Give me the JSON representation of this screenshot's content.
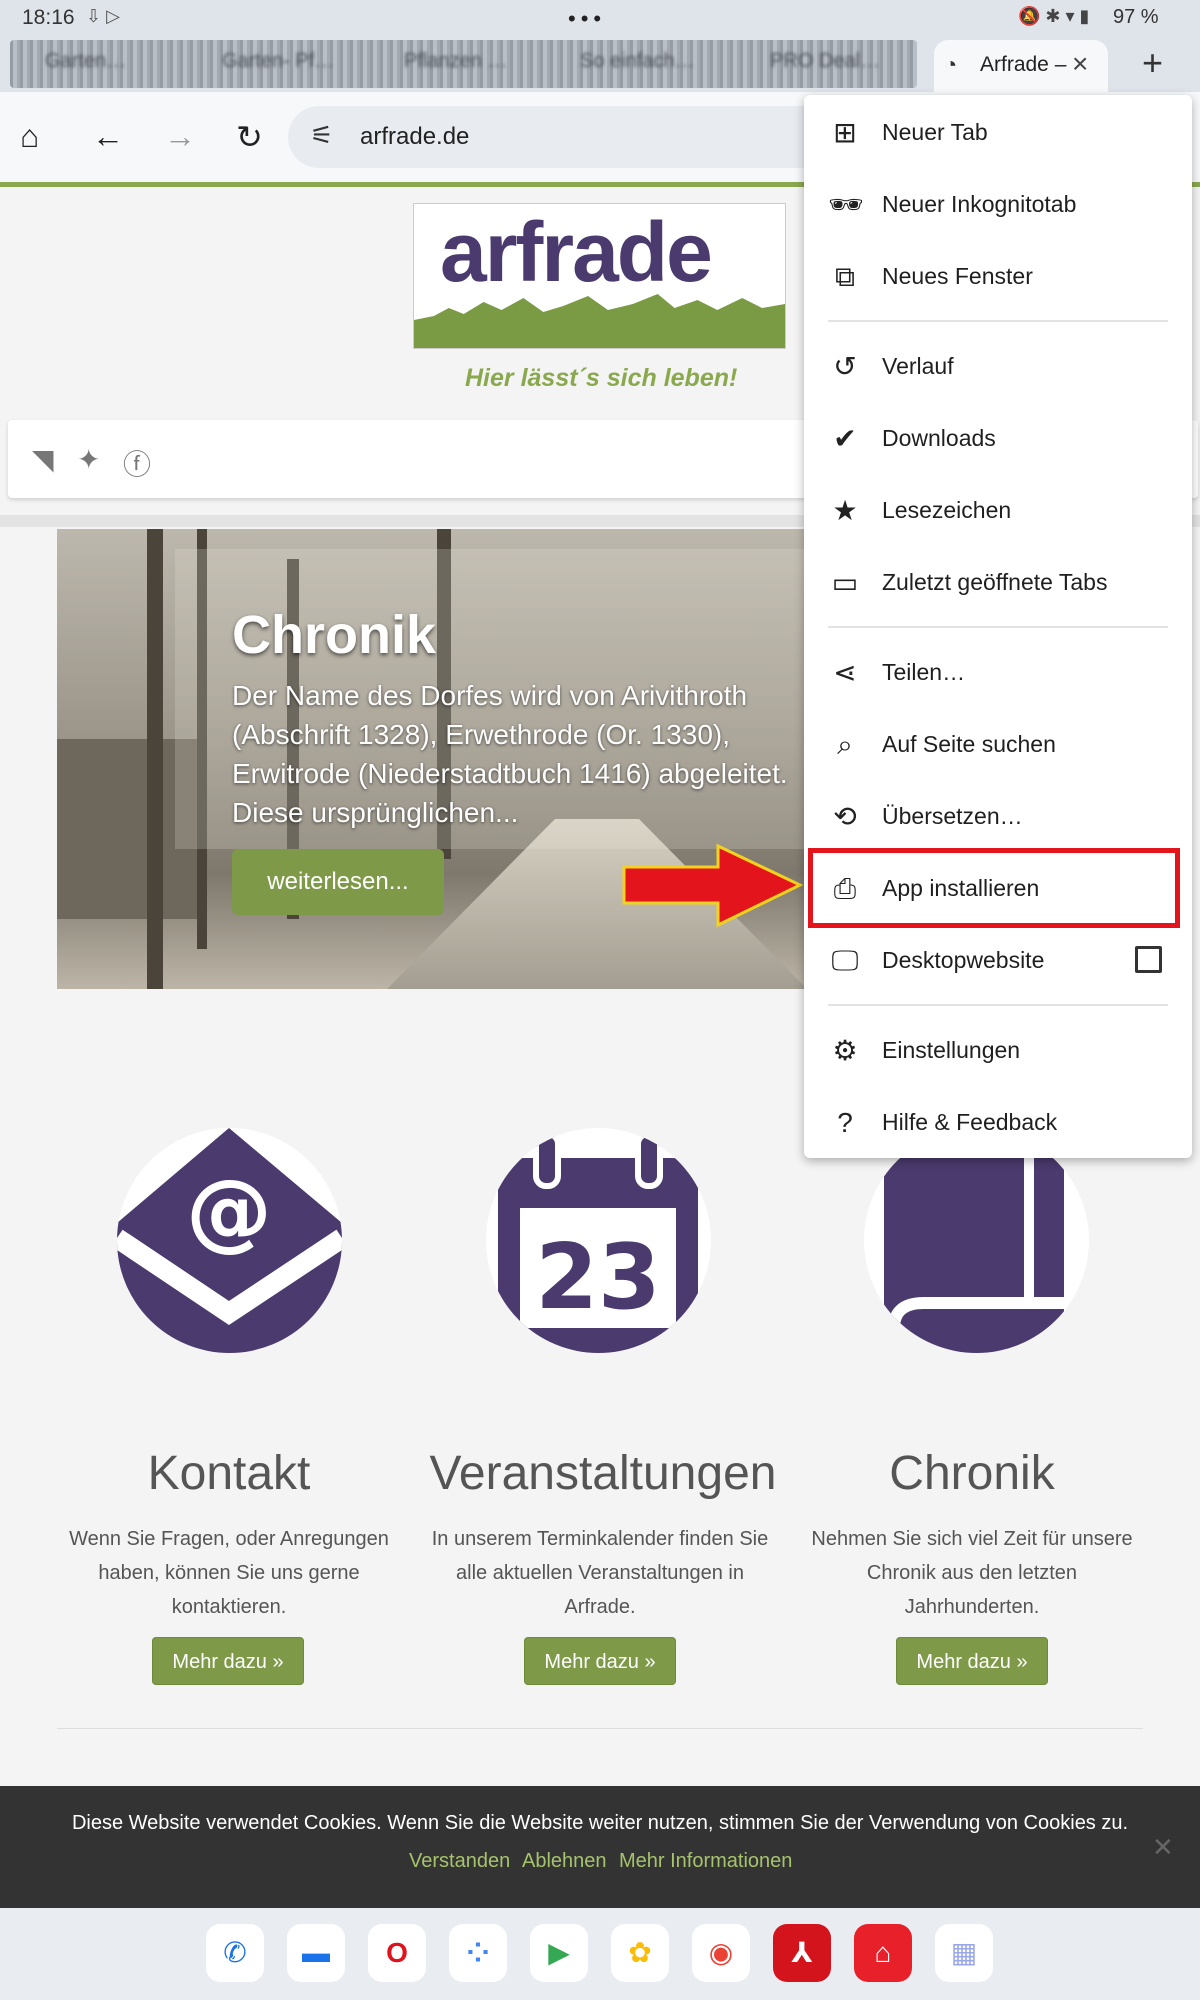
{
  "status_bar": {
    "time": "18:16",
    "battery": "97 %",
    "indicators": "⇩ ▷",
    "right_icons": "🔕 ✱ ▾ ▮"
  },
  "tabs": {
    "background_tabs": [
      "Garten…",
      "Garten- Pf…",
      "Pflanzen …",
      "So einfach…",
      "PRO Deal…"
    ],
    "active_tab": "Arfrade –",
    "new_tab_icon": "plus-icon"
  },
  "toolbar": {
    "url": "arfrade.de"
  },
  "header": {
    "logo_text": "arfrade",
    "tagline": "Hier lässt´s sich leben!"
  },
  "hero": {
    "title": "Chronik",
    "text": "Der Name des Dorfes wird von Arivithroth\n(Abschrift 1328), Erwethrode (Or. 1330),\nErwitrode (Niederstadtbuch 1416) abgeleitet.\nDiese ursprünglichen...",
    "button": "weiterlesen..."
  },
  "features": [
    {
      "title": "Kontakt",
      "text": "Wenn Sie Fragen, oder Anregungen haben, können Sie uns gerne kontaktieren.",
      "button": "Mehr dazu »",
      "icon": "email-at-icon"
    },
    {
      "title": "Veranstaltungen",
      "text": "In unserem Terminkalender finden Sie alle aktuellen Veranstaltungen in Arfrade.",
      "button": "Mehr dazu »",
      "icon": "calendar-icon",
      "calendar_day": "23"
    },
    {
      "title": "Chronik",
      "text": "Nehmen Sie sich viel Zeit für unsere Chronik aus den letzten Jahrhunderten.",
      "button": "Mehr dazu »",
      "icon": "book-icon"
    }
  ],
  "cookie_banner": {
    "message": "Diese Website verwendet Cookies. Wenn Sie die Website weiter nutzen, stimmen Sie der Verwendung von Cookies zu.",
    "accept": "Verstanden",
    "decline": "Ablehnen",
    "more": "Mehr Informationen"
  },
  "menu": {
    "items": [
      {
        "label": "Neuer Tab",
        "icon": "new-tab-icon"
      },
      {
        "label": "Neuer Inkognitotab",
        "icon": "incognito-icon"
      },
      {
        "label": "Neues Fenster",
        "icon": "new-window-icon"
      },
      {
        "label": "Verlauf",
        "icon": "history-icon"
      },
      {
        "label": "Downloads",
        "icon": "downloads-icon"
      },
      {
        "label": "Lesezeichen",
        "icon": "star-icon"
      },
      {
        "label": "Zuletzt geöffnete Tabs",
        "icon": "devices-icon"
      },
      {
        "label": "Teilen…",
        "icon": "share-icon"
      },
      {
        "label": "Auf Seite suchen",
        "icon": "find-in-page-icon"
      },
      {
        "label": "Übersetzen…",
        "icon": "translate-icon"
      },
      {
        "label": "App installieren",
        "icon": "install-app-icon",
        "highlighted": true
      },
      {
        "label": "Desktopwebsite",
        "icon": "desktop-icon",
        "checked": false
      },
      {
        "label": "Einstellungen",
        "icon": "gear-icon"
      },
      {
        "label": "Hilfe & Feedback",
        "icon": "help-icon"
      }
    ]
  },
  "dock": {
    "apps": [
      "phone",
      "messages",
      "opera",
      "assistant",
      "play-store",
      "photos",
      "chrome",
      "acrobat",
      "home-app",
      "app-drawer"
    ]
  },
  "colors": {
    "accent_green": "#7e9a48",
    "brand_purple": "#4b3a6e",
    "highlight_red": "#e3141c"
  }
}
